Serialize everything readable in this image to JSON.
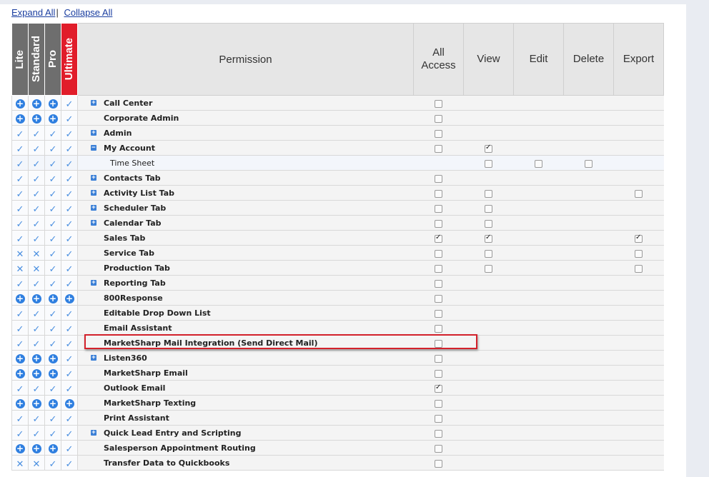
{
  "links": {
    "expand": "Expand All",
    "separator": "|",
    "collapse": "Collapse All"
  },
  "tiers": [
    "Lite",
    "Standard",
    "Pro",
    "Ultimate"
  ],
  "columns": {
    "permission": "Permission",
    "all_access": [
      "All",
      "Access"
    ],
    "view": "View",
    "edit": "Edit",
    "delete": "Delete",
    "export": "Export"
  },
  "colors": {
    "tier_header": "#6e6e6e",
    "ultimate_header": "#e11d2a",
    "accent": "#2f7fe0",
    "highlight": "#d3212b"
  },
  "rows": [
    {
      "label": "Call Center",
      "expander": "plus",
      "tiers": [
        "plus",
        "plus",
        "plus",
        "check"
      ],
      "cb": {
        "all": false
      }
    },
    {
      "label": "Corporate Admin",
      "expander": "none",
      "tiers": [
        "plus",
        "plus",
        "plus",
        "check"
      ],
      "cb": {
        "all": false
      }
    },
    {
      "label": "Admin",
      "expander": "plus",
      "tiers": [
        "check",
        "check",
        "check",
        "check"
      ],
      "cb": {
        "all": false
      }
    },
    {
      "label": "My Account",
      "expander": "minus",
      "tiers": [
        "check",
        "check",
        "check",
        "check"
      ],
      "cb": {
        "all": false,
        "view": true
      }
    },
    {
      "label": "Time Sheet",
      "child": true,
      "tiers": [
        "check",
        "check",
        "check",
        "check"
      ],
      "cb": {
        "view": false,
        "edit": false,
        "delete": false
      }
    },
    {
      "label": "Contacts Tab",
      "expander": "plus",
      "tiers": [
        "check",
        "check",
        "check",
        "check"
      ],
      "cb": {
        "all": false
      }
    },
    {
      "label": "Activity List Tab",
      "expander": "plus",
      "tiers": [
        "check",
        "check",
        "check",
        "check"
      ],
      "cb": {
        "all": false,
        "view": false,
        "export": false
      }
    },
    {
      "label": "Scheduler Tab",
      "expander": "plus",
      "tiers": [
        "check",
        "check",
        "check",
        "check"
      ],
      "cb": {
        "all": false,
        "view": false
      }
    },
    {
      "label": "Calendar Tab",
      "expander": "plus",
      "tiers": [
        "check",
        "check",
        "check",
        "check"
      ],
      "cb": {
        "all": false,
        "view": false
      }
    },
    {
      "label": "Sales Tab",
      "expander": "none",
      "tiers": [
        "check",
        "check",
        "check",
        "check"
      ],
      "cb": {
        "all": true,
        "view": true,
        "export": true
      }
    },
    {
      "label": "Service Tab",
      "expander": "none",
      "tiers": [
        "x",
        "x",
        "check",
        "check"
      ],
      "cb": {
        "all": false,
        "view": false,
        "export": false
      }
    },
    {
      "label": "Production Tab",
      "expander": "none",
      "tiers": [
        "x",
        "x",
        "check",
        "check"
      ],
      "cb": {
        "all": false,
        "view": false,
        "export": false
      }
    },
    {
      "label": "Reporting Tab",
      "expander": "plus",
      "tiers": [
        "check",
        "check",
        "check",
        "check"
      ],
      "cb": {
        "all": false
      }
    },
    {
      "label": "800Response",
      "expander": "none",
      "tiers": [
        "plus",
        "plus",
        "plus",
        "plus"
      ],
      "cb": {
        "all": false
      }
    },
    {
      "label": "Editable Drop Down List",
      "expander": "none",
      "tiers": [
        "check",
        "check",
        "check",
        "check"
      ],
      "cb": {
        "all": false
      }
    },
    {
      "label": "Email Assistant",
      "expander": "none",
      "tiers": [
        "check",
        "check",
        "check",
        "check"
      ],
      "cb": {
        "all": false
      }
    },
    {
      "label": "MarketSharp Mail Integration (Send Direct Mail)",
      "expander": "none",
      "tiers": [
        "check",
        "check",
        "check",
        "check"
      ],
      "cb": {
        "all": false
      }
    },
    {
      "label": "Listen360",
      "expander": "plus",
      "tiers": [
        "plus",
        "plus",
        "plus",
        "check"
      ],
      "cb": {
        "all": false
      }
    },
    {
      "label": "MarketSharp Email",
      "expander": "none",
      "tiers": [
        "plus",
        "plus",
        "plus",
        "check"
      ],
      "cb": {
        "all": false
      }
    },
    {
      "label": "Outlook Email",
      "expander": "none",
      "tiers": [
        "check",
        "check",
        "check",
        "check"
      ],
      "cb": {
        "all": true
      }
    },
    {
      "label": "MarketSharp Texting",
      "expander": "none",
      "tiers": [
        "plus",
        "plus",
        "plus",
        "plus"
      ],
      "cb": {
        "all": false
      }
    },
    {
      "label": "Print Assistant",
      "expander": "none",
      "tiers": [
        "check",
        "check",
        "check",
        "check"
      ],
      "cb": {
        "all": false
      }
    },
    {
      "label": "Quick Lead Entry and Scripting",
      "expander": "plus",
      "tiers": [
        "check",
        "check",
        "check",
        "check"
      ],
      "cb": {
        "all": false
      }
    },
    {
      "label": "Salesperson Appointment Routing",
      "expander": "none",
      "tiers": [
        "plus",
        "plus",
        "plus",
        "check"
      ],
      "cb": {
        "all": false
      }
    },
    {
      "label": "Transfer Data to Quickbooks",
      "expander": "none",
      "tiers": [
        "x",
        "x",
        "check",
        "check"
      ],
      "cb": {
        "all": false
      }
    }
  ]
}
